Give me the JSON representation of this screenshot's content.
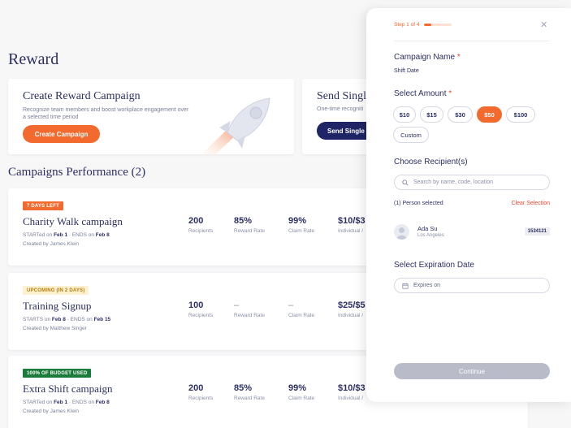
{
  "page": {
    "title": "Reward"
  },
  "reward_card": {
    "title": "Create Reward Campaign",
    "description": "Recognize team members and boost workplace engagement over a selected time period",
    "button": "Create Campaign",
    "illustration": "rocket-illustration"
  },
  "single_card": {
    "title": "Send Single",
    "description": "One-time recogniti",
    "button": "Send Single"
  },
  "campaigns_section": {
    "title": "Campaigns Performance (2)"
  },
  "campaigns": [
    {
      "badge": "7 DAYS LEFT",
      "name": "Charity Walk campaign",
      "start_label": "STARTed on",
      "start": "Feb 1",
      "end_label": "ENDS on",
      "end": "Feb 8",
      "creator": "Created by James Klein",
      "recipients": "200",
      "recipients_label": "Recipients",
      "reward_rate": "85%",
      "reward_rate_label": "Reward Rate",
      "claim_rate": "99%",
      "claim_rate_label": "Claim Rate",
      "amount": "$10/$3",
      "amount_label": "Individual /"
    },
    {
      "badge": "UPCOMING (IN 2 DAYS)",
      "name": "Training Signup",
      "start_label": "STARTS on",
      "start": "Feb 8",
      "end_label": "ENDS on",
      "end": "Feb 15",
      "creator": "Created by Matthew Singer",
      "recipients": "100",
      "recipients_label": "Recipients",
      "reward_rate": "–",
      "reward_rate_label": "Reward Rate",
      "claim_rate": "–",
      "claim_rate_label": "Claim Rate",
      "amount": "$25/$5",
      "amount_label": "Individual /"
    },
    {
      "badge": "100% OF BUDGET USED",
      "name": "Extra Shift campaign",
      "start_label": "STARTed on",
      "start": "Feb 1",
      "end_label": "ENDS on",
      "end": "Feb 8",
      "creator": "Created by James Klein",
      "recipients": "200",
      "recipients_label": "Recipients",
      "reward_rate": "85%",
      "reward_rate_label": "Reward Rate",
      "claim_rate": "99%",
      "claim_rate_label": "Claim Rate",
      "amount": "$10/$3",
      "amount_label": "Individual /"
    }
  ],
  "panel": {
    "step": "Step 1 of 4",
    "progress_fraction": 0.25,
    "campaign_name_label": "Campaign Name",
    "campaign_name_value": "Shift Date",
    "select_amount_label": "Select Amount",
    "amounts": [
      "$10",
      "$15",
      "$30",
      "$50",
      "$100",
      "Custom"
    ],
    "selected_amount": "$50",
    "recipients_label": "Choose Recipient(s)",
    "search_placeholder": "Search by name, code, location",
    "selected_count": "(1) Person selected",
    "clear_selection": "Clear Selection",
    "person": {
      "name": "Ada Su",
      "location": "Los Angeles",
      "code": "1534121"
    },
    "expiration_label": "Select Expiration Date",
    "expiration_placeholder": "Expires on",
    "continue": "Continue"
  },
  "colors": {
    "accent": "#f26a2e",
    "navy": "#1f2466",
    "text": "#2b2f63",
    "required": "#f0442e"
  }
}
